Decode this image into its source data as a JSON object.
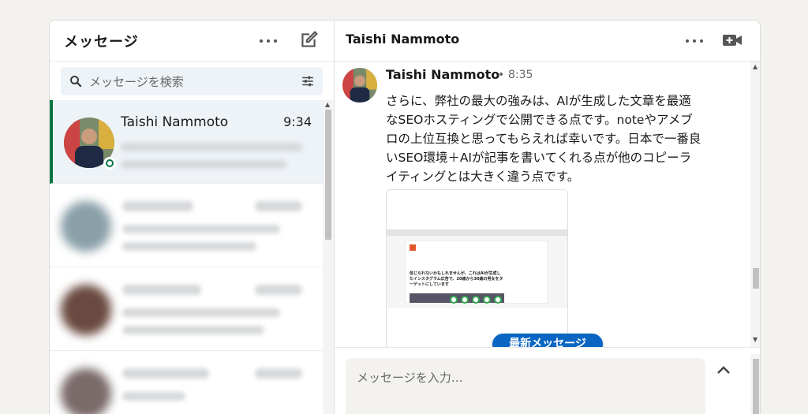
{
  "left": {
    "title": "メッセージ",
    "search_placeholder": "メッセージを検索"
  },
  "conversations": [
    {
      "name": "Taishi Nammoto",
      "time": "9:34",
      "online": true
    }
  ],
  "thread": {
    "title": "Taishi Nammoto",
    "message": {
      "sender": "Taishi Nammoto",
      "separator": "•",
      "time": "8:35",
      "text": "さらに、弊社の最大の強みは、AIが生成した文章を最適なSEOホスティングで公開できる点です。noteやアメブロの上位互換と思ってもらえれば幸いです。日本で一番良いSEO環境＋AIが記事を書いてくれる点が他のコピーライティングとは大きく違う点です。",
      "attachment_headline": "信じられないかもしれませんが、これはAIが生成したインスタグラム広告で、20歳から30歳の男女をターゲットにしています"
    },
    "latest_button": "最新メッセージ",
    "composer_placeholder": "メッセージを入力…"
  },
  "colors": {
    "accent": "#0a66c2",
    "online": "#057642",
    "active_bg": "#eef3f8"
  }
}
